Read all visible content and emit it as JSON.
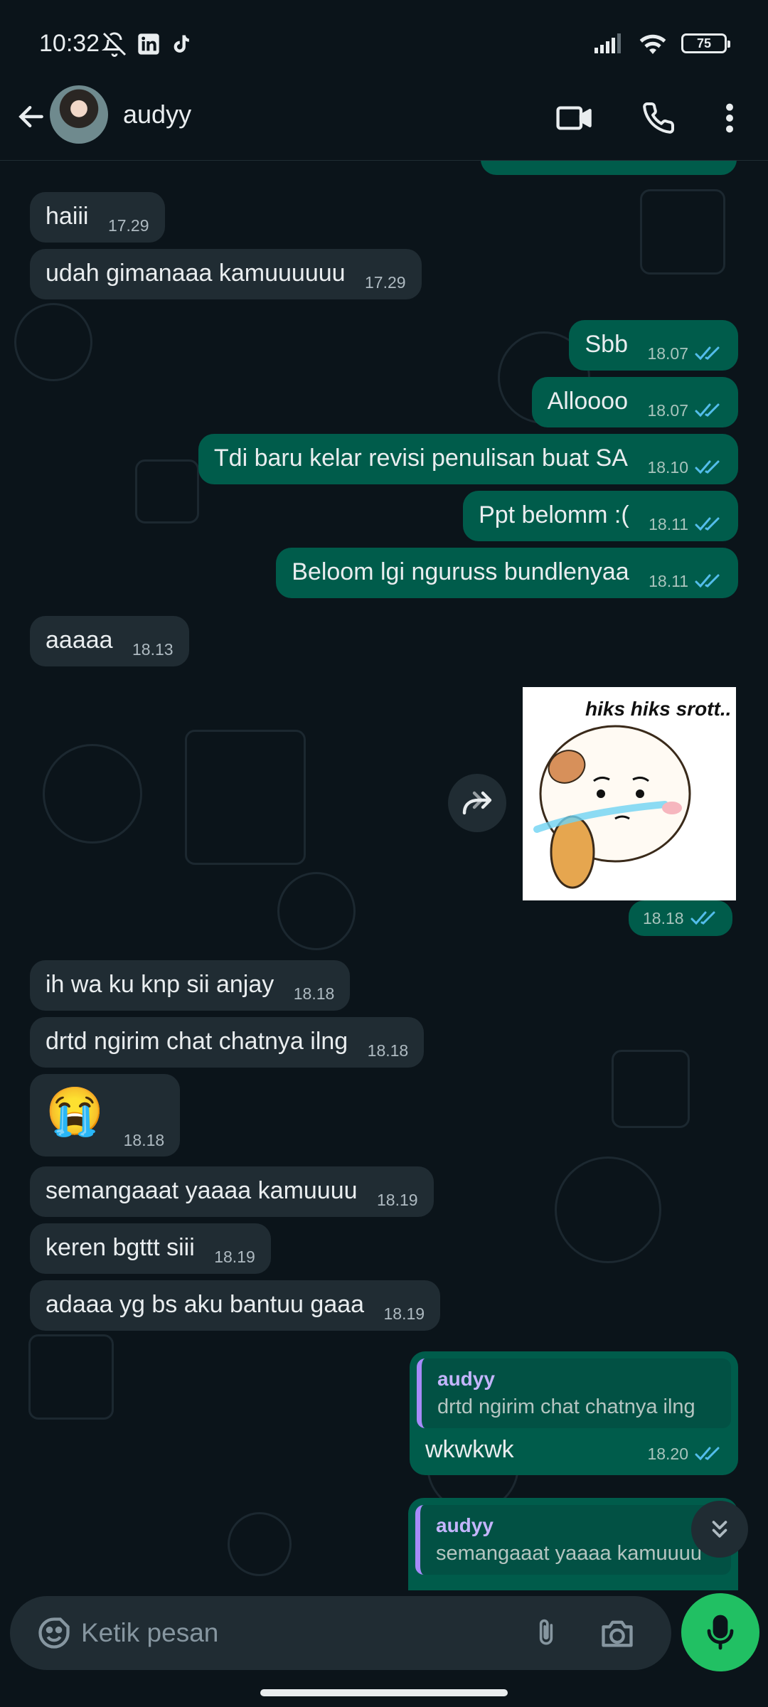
{
  "status_bar": {
    "time": "10:32",
    "battery": "75"
  },
  "header": {
    "contact_name": "audyy"
  },
  "messages": [
    {
      "dir": "in",
      "text": "haiii",
      "time": "17.29"
    },
    {
      "dir": "in",
      "text": "udah gimanaaa kamuuuuuu",
      "time": "17.29"
    },
    {
      "dir": "out",
      "text": "Sbb",
      "time": "18.07"
    },
    {
      "dir": "out",
      "text": "Alloooo",
      "time": "18.07"
    },
    {
      "dir": "out",
      "text": "Tdi baru kelar revisi penulisan buat SA",
      "time": "18.10"
    },
    {
      "dir": "out",
      "text": "Ppt belomm :(",
      "time": "18.11"
    },
    {
      "dir": "out",
      "text": "Beloom lgi nguruss bundlenyaa",
      "time": "18.11"
    },
    {
      "dir": "in",
      "text": "aaaaa",
      "time": "18.13"
    },
    {
      "dir": "in",
      "text": "ih wa ku knp sii anjay",
      "time": "18.18"
    },
    {
      "dir": "in",
      "text": "drtd ngirim chat chatnya ilng",
      "time": "18.18"
    },
    {
      "dir": "in",
      "text": "😭",
      "time": "18.18"
    },
    {
      "dir": "in",
      "text": "semangaaat yaaaa kamuuuu",
      "time": "18.19"
    },
    {
      "dir": "in",
      "text": "keren bgttt siii",
      "time": "18.19"
    },
    {
      "dir": "in",
      "text": "adaaa yg bs aku bantuu gaaa",
      "time": "18.19"
    }
  ],
  "sticker": {
    "caption": "hiks hiks srott..",
    "time": "18.18"
  },
  "replies": [
    {
      "quote_name": "audyy",
      "quote_text": "drtd ngirim chat chatnya ilng",
      "text": "wkwkwk",
      "time": "18.20"
    },
    {
      "quote_name": "audyy",
      "quote_text": "semangaaat yaaaa kamuuuu"
    }
  ],
  "composer": {
    "placeholder": "Ketik pesan"
  },
  "colors": {
    "background": "#0b141a",
    "incoming": "#202c33",
    "outgoing": "#005c4b",
    "accent": "#21c063",
    "read_tick": "#53bdeb"
  }
}
